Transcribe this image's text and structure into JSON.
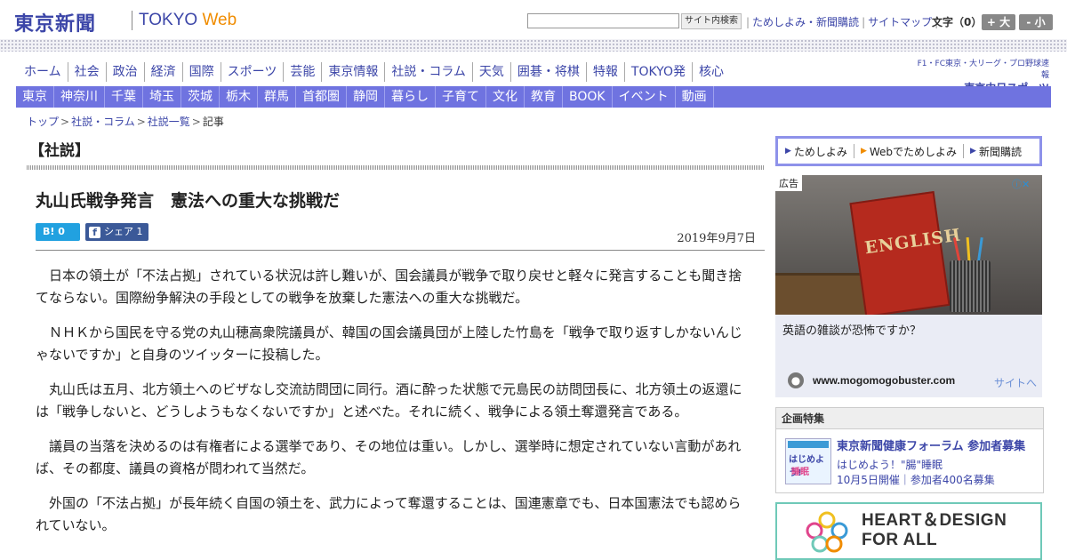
{
  "header": {
    "logo_jp": "東京新聞",
    "logo_en_tokyo": "TOKYO",
    "logo_en_web": "Web",
    "search_button": "サイト内検索",
    "links": [
      "ためしよみ・新聞購読",
      "サイトマップ"
    ],
    "font_size_label": "文字（0）",
    "font_plus": "+ 大",
    "font_minus": "- 小"
  },
  "main_nav": [
    "ホーム",
    "社会",
    "政治",
    "経済",
    "国際",
    "スポーツ",
    "芸能",
    "東京情報",
    "社説・コラム",
    "天気",
    "囲碁・将棋",
    "特報",
    "TOKYO発",
    "核心"
  ],
  "chunichi": {
    "top": "F1・FC東京・大リーグ・プロ野球速報",
    "bottom": "東京中日スポーツ"
  },
  "regional_nav": [
    "東京",
    "神奈川",
    "千葉",
    "埼玉",
    "茨城",
    "栃木",
    "群馬",
    "首都圏",
    "静岡",
    "暮らし",
    "子育て",
    "文化",
    "教育",
    "BOOK",
    "イベント",
    "動画"
  ],
  "breadcrumb": {
    "items": [
      "トップ",
      "社説・コラム",
      "社説一覧"
    ],
    "current": "記事"
  },
  "article": {
    "section": "【社説】",
    "title": "丸山氏戦争発言　憲法への重大な挑戦だ",
    "hatena": "B! 0",
    "fb_share": "シェア 1",
    "fb_icon": "f",
    "date": "2019年9月7日",
    "paragraphs": [
      "日本の領土が「不法占拠」されている状況は許し難いが、国会議員が戦争で取り戻せと軽々に発言することも聞き捨てならない。国際紛争解決の手段としての戦争を放棄した憲法への重大な挑戦だ。",
      "ＮＨＫから国民を守る党の丸山穂高衆院議員が、韓国の国会議員団が上陸した竹島を「戦争で取り返すしかないんじゃないですか」と自身のツイッターに投稿した。",
      "丸山氏は五月、北方領土へのビザなし交流訪問団に同行。酒に酔った状態で元島民の訪問団長に、北方領土の返還には「戦争しないと、どうしようもなくないですか」と述べた。それに続く、戦争による領土奪還発言である。",
      "議員の当落を決めるのは有権者による選挙であり、その地位は重い。しかし、選挙時に想定されていない言動があれば、その都度、議員の資格が問われて当然だ。",
      "外国の「不法占拠」が長年続く自国の領土を、武力によって奪還することは、国連憲章でも、日本国憲法でも認められていない。"
    ]
  },
  "sidebar": {
    "subscribe": [
      "ためしよみ",
      "Webでためしよみ",
      "新聞購読"
    ],
    "ad": {
      "label": "広告",
      "book_text": "ENGLISH",
      "headline": "英語の雑談が恐怖ですか？",
      "url": "www.mogomogobuster.com",
      "site_link": "サイトへ"
    },
    "kikaku": {
      "heading": "企画特集",
      "thumb_text1": "はじめよう!",
      "thumb_text2": "睡眠",
      "title": "東京新聞健康フォーラム 参加者募集",
      "subtitle": "はじめよう！\"腸\"睡眠",
      "date": "10月5日開催｜参加者400名募集"
    },
    "heart": {
      "line1": "HEART＆DESIGN",
      "line2": "FOR ALL"
    }
  },
  "colors": {
    "brand_blue": "#3c46a8",
    "regional_nav": "#6f73e0",
    "accent_orange": "#f08c00",
    "hatena": "#21a1e0",
    "facebook": "#3b5998"
  }
}
